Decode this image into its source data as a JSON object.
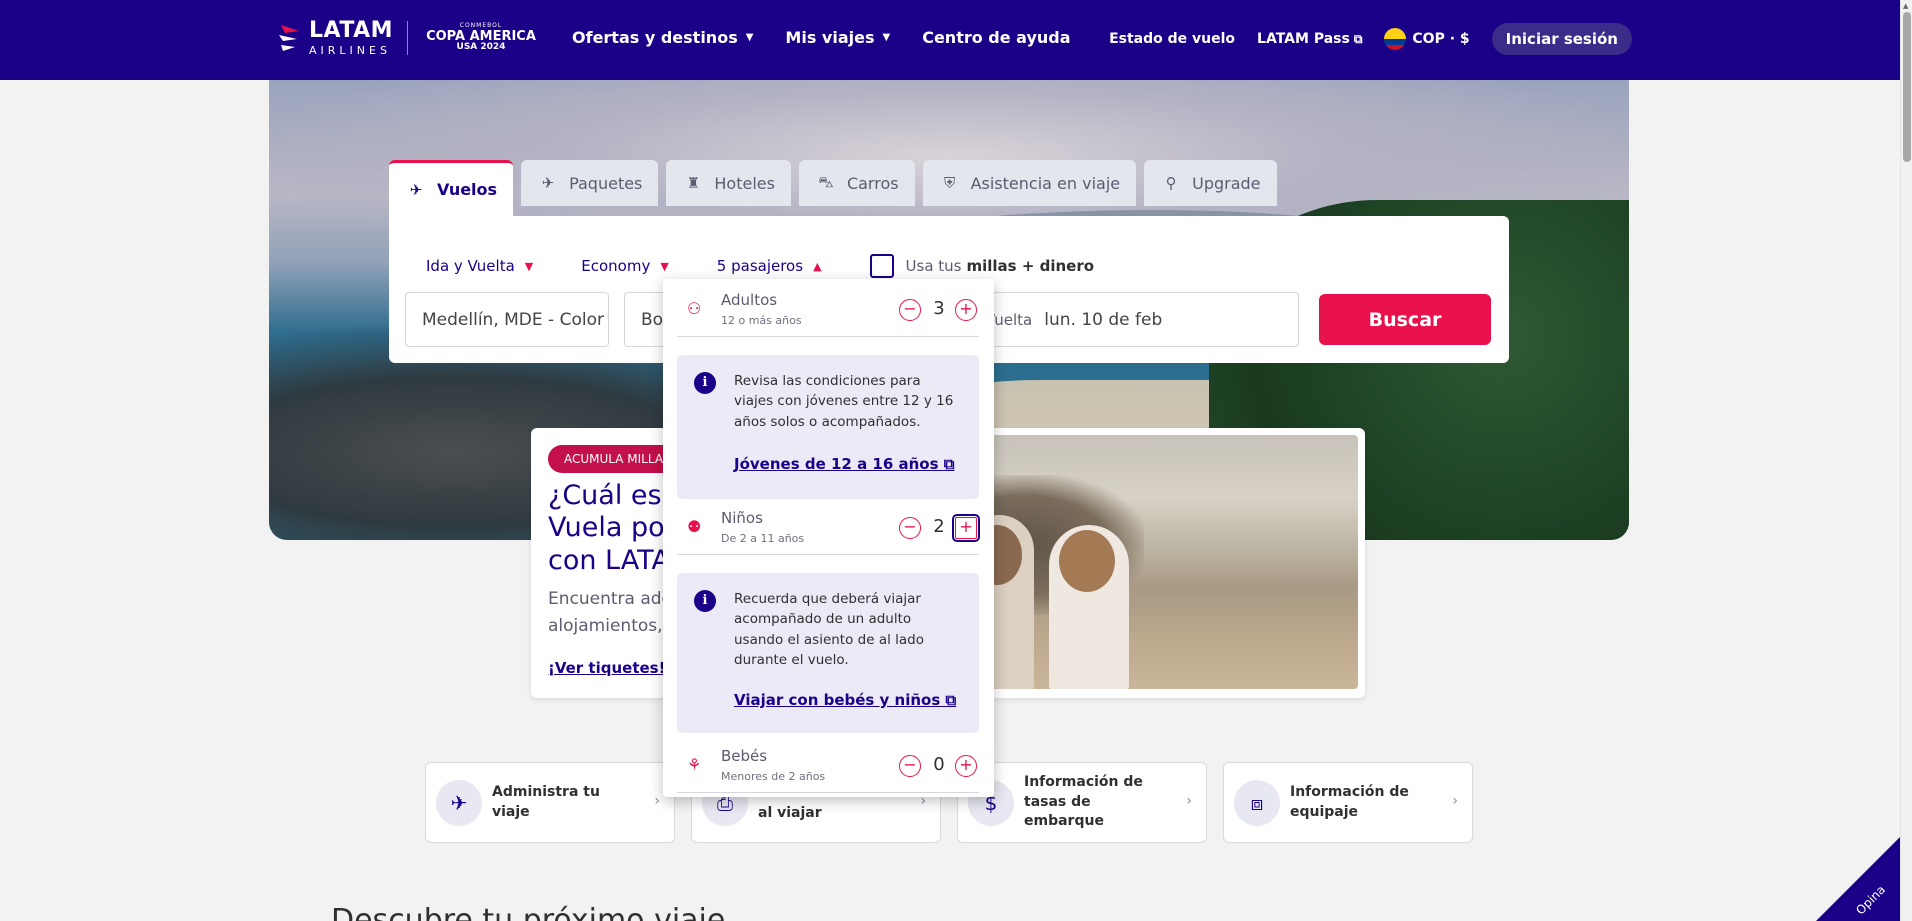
{
  "nav": {
    "logo_main": "LATAM",
    "logo_sub": "AIRLINES",
    "copa_top": "CONMEBOL",
    "copa_mid": "COPA AMERICA",
    "copa_bot": "USA 2024",
    "menu": [
      {
        "label": "Ofertas y destinos",
        "chevron": true
      },
      {
        "label": "Mis viajes",
        "chevron": true
      },
      {
        "label": "Centro de ayuda",
        "chevron": false
      }
    ],
    "estado": "Estado de vuelo",
    "pass": "LATAM Pass",
    "currency": "COP · $",
    "login": "Iniciar sesión"
  },
  "tabs": [
    {
      "label": "Vuelos",
      "icon": "plane-icon",
      "glyph": "✈",
      "active": true
    },
    {
      "label": "Paquetes",
      "icon": "package-icon",
      "glyph": "✈",
      "active": false
    },
    {
      "label": "Hoteles",
      "icon": "hotel-icon",
      "glyph": "♜",
      "active": false
    },
    {
      "label": "Carros",
      "icon": "car-icon",
      "glyph": "⛍",
      "active": false
    },
    {
      "label": "Asistencia en viaje",
      "icon": "shield-icon",
      "glyph": "⛨",
      "active": false
    },
    {
      "label": "Upgrade",
      "icon": "upgrade-icon",
      "glyph": "⚲",
      "active": false
    }
  ],
  "search": {
    "trip_type": "Ida y Vuelta",
    "cabin": "Economy",
    "passengers": "5 pasajeros",
    "miles_prefix": "Usa tus",
    "miles_bold": "millas + dinero",
    "origin": "Medellín, MDE - Color",
    "destination": "Bo",
    "return_label": "Vuelta",
    "return_date": "lun. 10 de feb",
    "button": "Buscar"
  },
  "promo": {
    "tag": "ACUMULA MILLAS",
    "title": "¿Cuál es t\nVuela por\ncon LATAM",
    "desc": "Encuentra ader\nalojamientos, s",
    "link": "¡Ver tiquetes!"
  },
  "quick_links": [
    {
      "label": "Administra tu viaje",
      "icon": "plane-icon",
      "glyph": "✈"
    },
    {
      "label": "al viajar",
      "icon": "document-icon",
      "glyph": "⎙"
    },
    {
      "label": "Información de tasas de embarque",
      "icon": "fee-icon",
      "glyph": "$"
    },
    {
      "label": "Información de equipaje",
      "icon": "luggage-icon",
      "glyph": "⧈"
    }
  ],
  "bottom_heading": "Descubre tu próximo viaje",
  "passengers_dropdown": {
    "adults": {
      "label": "Adultos",
      "sub": "12 o más años",
      "count": "3"
    },
    "info1": {
      "text": "Revisa las condiciones para viajes con jóvenes entre 12 y 16 años solos o acompañados.",
      "link": "Jóvenes de 12 a 16 años"
    },
    "children": {
      "label": "Niños",
      "sub": "De 2 a 11 años",
      "count": "2"
    },
    "info2": {
      "text": "Recuerda que deberá viajar acompañado de un adulto usando el asiento de al lado durante el vuelo.",
      "link": "Viajar con bebés y niños"
    },
    "infants": {
      "label": "Bebés",
      "sub": "Menores de 2 años",
      "count": "0"
    },
    "minus": "−",
    "plus": "+"
  },
  "opina": "Opina",
  "colors": {
    "brand": "#1b0088",
    "accent": "#e8114b"
  }
}
